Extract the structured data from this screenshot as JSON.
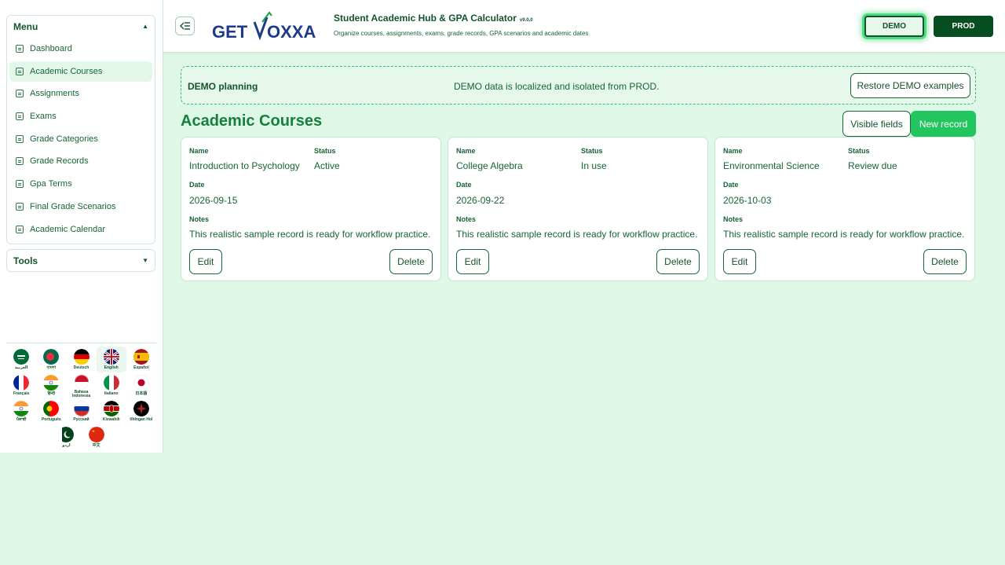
{
  "sidebar": {
    "menu_title": "Menu",
    "tools_title": "Tools",
    "items": [
      {
        "label": "Dashboard"
      },
      {
        "label": "Academic Courses"
      },
      {
        "label": "Assignments"
      },
      {
        "label": "Exams"
      },
      {
        "label": "Grade Categories"
      },
      {
        "label": "Grade Records"
      },
      {
        "label": "Gpa Terms"
      },
      {
        "label": "Final Grade Scenarios"
      },
      {
        "label": "Academic Calendar"
      }
    ],
    "languages": [
      {
        "name": "العربية",
        "flag": "sa"
      },
      {
        "name": "বাংলা",
        "flag": "bd"
      },
      {
        "name": "Deutsch",
        "flag": "de"
      },
      {
        "name": "English",
        "flag": "gb"
      },
      {
        "name": "Español",
        "flag": "es"
      },
      {
        "name": "Français",
        "flag": "fr"
      },
      {
        "name": "हिन्दी",
        "flag": "in"
      },
      {
        "name": "Bahasa Indonesia",
        "flag": "id"
      },
      {
        "name": "Italiano",
        "flag": "it"
      },
      {
        "name": "日本語",
        "flag": "jp"
      },
      {
        "name": "ਪੰਜਾਬੀ",
        "flag": "in"
      },
      {
        "name": "Português",
        "flag": "pt"
      },
      {
        "name": "Русский",
        "flag": "ru"
      },
      {
        "name": "Kiswahili",
        "flag": "ke"
      },
      {
        "name": "tlhIngan Hol",
        "flag": "kl"
      },
      {
        "name": "اردو",
        "flag": "pk"
      },
      {
        "name": "中文",
        "flag": "cn"
      }
    ]
  },
  "header": {
    "logo_text_left": "GET",
    "logo_text_right": "OXXA",
    "title": "Student Academic Hub & GPA Calculator",
    "version": "v9.0.0",
    "subtitle": "Organize courses, assignments, exams, grade records, GPA scenarios and academic dates",
    "demo_label": "DEMO",
    "prod_label": "PROD"
  },
  "banner": {
    "title": "DEMO planning",
    "text": "DEMO data is localized and isolated from PROD.",
    "restore_label": "Restore DEMO examples"
  },
  "main": {
    "title": "Academic Courses",
    "visible_fields_label": "Visible fields",
    "new_record_label": "New record",
    "field_labels": {
      "name": "Name",
      "status": "Status",
      "date": "Date",
      "notes": "Notes"
    },
    "edit_label": "Edit",
    "delete_label": "Delete",
    "cards": [
      {
        "name": "Introduction to Psychology",
        "status": "Active",
        "date": "2026-09-15",
        "notes": "This realistic sample record is ready for workflow practice."
      },
      {
        "name": "College Algebra",
        "status": "In use",
        "date": "2026-09-22",
        "notes": "This realistic sample record is ready for workflow practice."
      },
      {
        "name": "Environmental Science",
        "status": "Review due",
        "date": "2026-10-03",
        "notes": "This realistic sample record is ready for workflow practice."
      }
    ]
  },
  "colors": {
    "accent": "#22c55e",
    "dark_green": "#14532d",
    "background": "#dff7e6"
  }
}
